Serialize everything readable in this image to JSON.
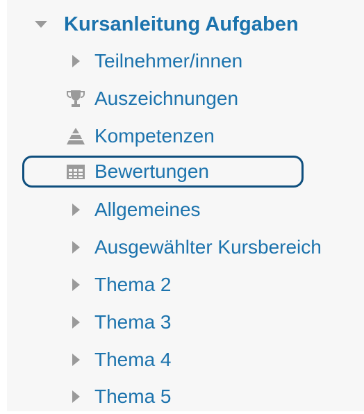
{
  "nav": {
    "course_title": "Kursanleitung Aufgaben",
    "items": [
      {
        "label": "Teilnehmer/innen",
        "icon": "caret-right-icon"
      },
      {
        "label": "Auszeichnungen",
        "icon": "trophy-icon"
      },
      {
        "label": "Kompetenzen",
        "icon": "competency-icon"
      },
      {
        "label": "Bewertungen",
        "icon": "gradebook-table-icon",
        "highlighted": true
      },
      {
        "label": "Allgemeines",
        "icon": "caret-right-icon"
      },
      {
        "label": "Ausgewählter Kursbereich",
        "icon": "caret-right-icon"
      },
      {
        "label": "Thema 2",
        "icon": "caret-right-icon"
      },
      {
        "label": "Thema 3",
        "icon": "caret-right-icon"
      },
      {
        "label": "Thema 4",
        "icon": "caret-right-icon"
      },
      {
        "label": "Thema 5",
        "icon": "caret-right-icon"
      }
    ]
  },
  "colors": {
    "link": "#1c73ad",
    "icon": "#9a9a9a",
    "highlight_border": "#0f4f7e",
    "panel_background": "#f7f7f7"
  }
}
